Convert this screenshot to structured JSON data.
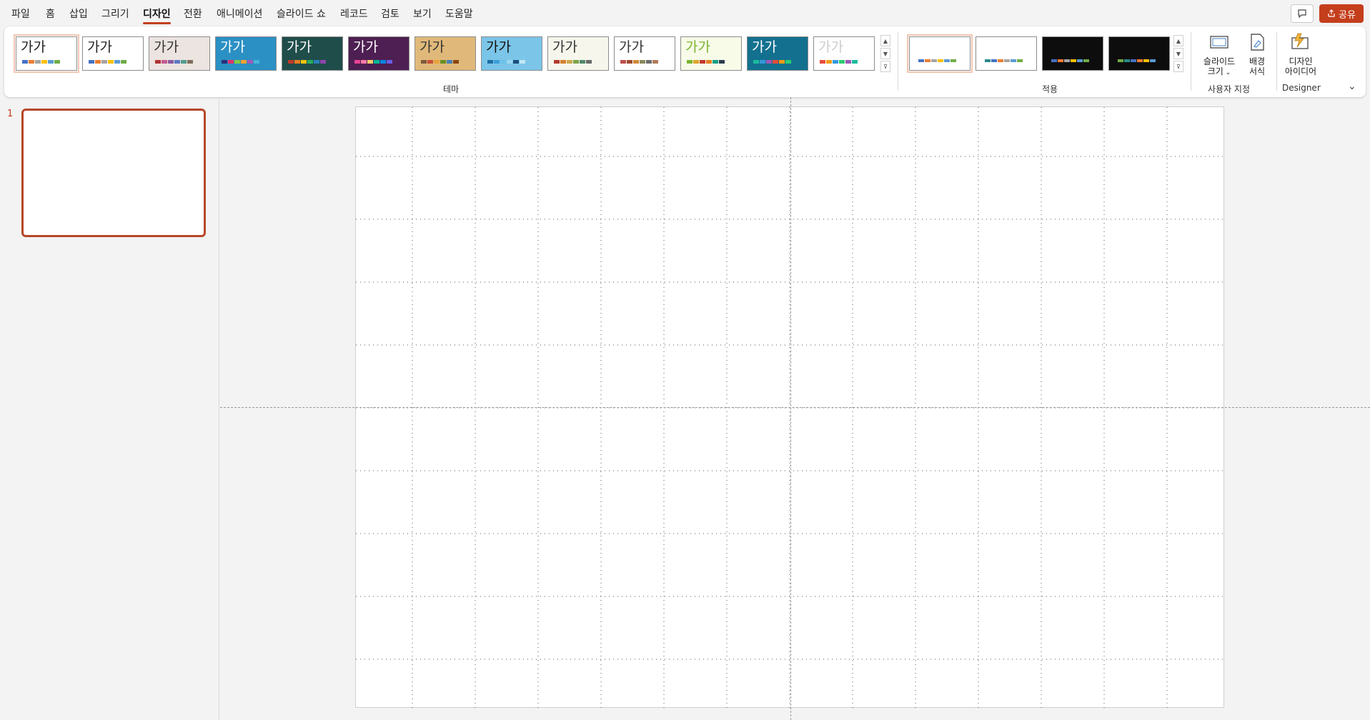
{
  "menu": {
    "items": [
      "파일",
      "홈",
      "삽입",
      "그리기",
      "디자인",
      "전환",
      "애니메이션",
      "슬라이드 쇼",
      "레코드",
      "검토",
      "보기",
      "도움말"
    ],
    "active": "디자인"
  },
  "header": {
    "share_label": "공유",
    "comment_icon": "comment-icon",
    "share_icon": "share-icon"
  },
  "ribbon": {
    "themes_group_label": "테마",
    "variants_group_label": "적용",
    "customize_group_label": "사용자 지정",
    "designer_group_label": "Designer",
    "theme_sample_text": "가가",
    "slide_size_label_line1": "슬라이드",
    "slide_size_label_line2": "크기",
    "format_background_label_line1": "배경",
    "format_background_label_line2": "서식",
    "design_ideas_label_line1": "디자인",
    "design_ideas_label_line2": "아이디어",
    "themes": [
      {
        "name": "Office",
        "bg": "#ffffff",
        "text": "#222222",
        "selected": true,
        "bars": [
          "#4472c4",
          "#ed7d31",
          "#a5a5a5",
          "#ffc000",
          "#5b9bd5",
          "#70ad47"
        ]
      },
      {
        "name": "Office2",
        "bg": "#ffffff",
        "text": "#222222",
        "selected": false,
        "bars": [
          "#4472c4",
          "#ed7d31",
          "#a5a5a5",
          "#ffc000",
          "#5b9bd5",
          "#70ad47"
        ]
      },
      {
        "name": "Berlin",
        "bg": "#ece4e0",
        "text": "#333333",
        "selected": false,
        "bars": [
          "#b03434",
          "#c55a91",
          "#8a5aa0",
          "#5b79c4",
          "#4f9d8c",
          "#7e6d5c"
        ]
      },
      {
        "name": "Facet",
        "bg": "#2b90c4",
        "text": "#ffffff",
        "selected": false,
        "bars": [
          "#2a2f7a",
          "#e0356b",
          "#7fcc45",
          "#f3a32f",
          "#9e5ab8",
          "#45b6d8"
        ]
      },
      {
        "name": "Ion",
        "bg": "#1f4d4a",
        "text": "#ffffff",
        "selected": false,
        "bars": [
          "#c0392b",
          "#e67e22",
          "#f1c40f",
          "#27ae60",
          "#2980b9",
          "#8e44ad"
        ]
      },
      {
        "name": "IonBoard",
        "bg": "#4d1f52",
        "text": "#ffffff",
        "selected": false,
        "bars": [
          "#e84393",
          "#fd79a8",
          "#fdcb6e",
          "#00b894",
          "#0984e3",
          "#6c5ce7"
        ]
      },
      {
        "name": "Wood",
        "bg": "#e0b97a",
        "text": "#333333",
        "selected": false,
        "bars": [
          "#7d5a3c",
          "#c8503a",
          "#e9a23b",
          "#6b8e23",
          "#4682b4",
          "#8b4513"
        ]
      },
      {
        "name": "Mesh",
        "bg": "#7bc5e8",
        "text": "#111111",
        "selected": false,
        "bars": [
          "#1f6fa3",
          "#3aa0d8",
          "#6cc2e8",
          "#9bd6ef",
          "#1a4d7a",
          "#c2e6f5"
        ]
      },
      {
        "name": "Organic",
        "bg": "#f6f6ec",
        "text": "#333333",
        "selected": false,
        "bars": [
          "#b23a2b",
          "#d4812c",
          "#c9a94c",
          "#7fa34a",
          "#4f8a6b",
          "#6a6a6a"
        ]
      },
      {
        "name": "Retrospect",
        "bg": "#ffffff",
        "text": "#333333",
        "selected": false,
        "bars": [
          "#c0504d",
          "#9e4a2e",
          "#d08a3b",
          "#8a8a5c",
          "#6d6d6d",
          "#b07b5b"
        ]
      },
      {
        "name": "Slice",
        "bg": "#f7fbe8",
        "text": "#7ab532",
        "selected": false,
        "bars": [
          "#7ab532",
          "#dfa62b",
          "#c0392b",
          "#e67e22",
          "#16a085",
          "#2c3e50"
        ]
      },
      {
        "name": "Vapor",
        "bg": "#13708f",
        "text": "#ffffff",
        "selected": false,
        "bars": [
          "#1abc9c",
          "#3498db",
          "#9b59b6",
          "#e74c3c",
          "#f39c12",
          "#2ecc71"
        ]
      },
      {
        "name": "Gallery",
        "bg": "#ffffff",
        "text": "#cccccc",
        "selected": false,
        "bars": [
          "#e74c3c",
          "#f39c12",
          "#3498db",
          "#2ecc71",
          "#9b59b6",
          "#1abc9c"
        ]
      }
    ],
    "variants": [
      {
        "bg": "#ffffff",
        "selected": true,
        "bars": [
          "#4472c4",
          "#ed7d31",
          "#a5a5a5",
          "#ffc000",
          "#5b9bd5",
          "#70ad47"
        ]
      },
      {
        "bg": "#ffffff",
        "selected": false,
        "bars": [
          "#2b8a8a",
          "#4472c4",
          "#ed7d31",
          "#a5a5a5",
          "#5b9bd5",
          "#70ad47"
        ]
      },
      {
        "bg": "#0d0d0d",
        "selected": false,
        "bars": [
          "#4472c4",
          "#ed7d31",
          "#a5a5a5",
          "#ffc000",
          "#5b9bd5",
          "#70ad47"
        ]
      },
      {
        "bg": "#0d0d0d",
        "selected": false,
        "bars": [
          "#70ad47",
          "#2b8a8a",
          "#4472c4",
          "#ed7d31",
          "#ffc000",
          "#5b9bd5"
        ]
      }
    ]
  },
  "slides": {
    "items": [
      {
        "number": "1",
        "selected": true
      }
    ]
  },
  "colors": {
    "accent": "#c43e1c",
    "thumb_border": "#b7472a",
    "canvas": "#ffffff",
    "background": "#f3f3f3"
  }
}
